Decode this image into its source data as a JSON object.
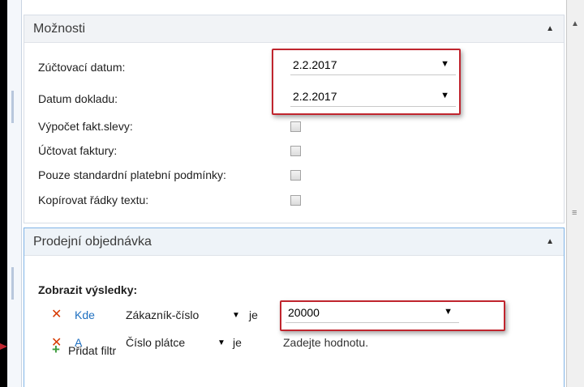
{
  "moznosti": {
    "title": "Možnosti",
    "fields": {
      "zuctovaci_datum": {
        "label": "Zúčtovací datum:",
        "value": "2.2.2017"
      },
      "datum_dokladu": {
        "label": "Datum dokladu:",
        "value": "2.2.2017"
      },
      "vypocet": {
        "label": "Výpočet fakt.slevy:",
        "checked": false
      },
      "uctovat": {
        "label": "Účtovat faktury:",
        "checked": false
      },
      "pouze": {
        "label": "Pouze standardní platební podmínky:",
        "checked": false
      },
      "kopirovat": {
        "label": "Kopírovat řádky textu:",
        "checked": false
      }
    }
  },
  "prodejni": {
    "title": "Prodejní objednávka",
    "results_label": "Zobrazit výsledky:",
    "filters": [
      {
        "conj": "Kde",
        "field": "Zákazník-číslo",
        "op": "je",
        "value": "20000"
      },
      {
        "conj": "A",
        "field": "Číslo plátce",
        "op": "je",
        "value": "Zadejte hodnotu."
      }
    ],
    "add_filter": "Přidat filtr"
  },
  "colors": {
    "highlight": "#c0252e",
    "link": "#1e6fc0",
    "remove": "#d83b01",
    "add": "#3d9c3d"
  }
}
